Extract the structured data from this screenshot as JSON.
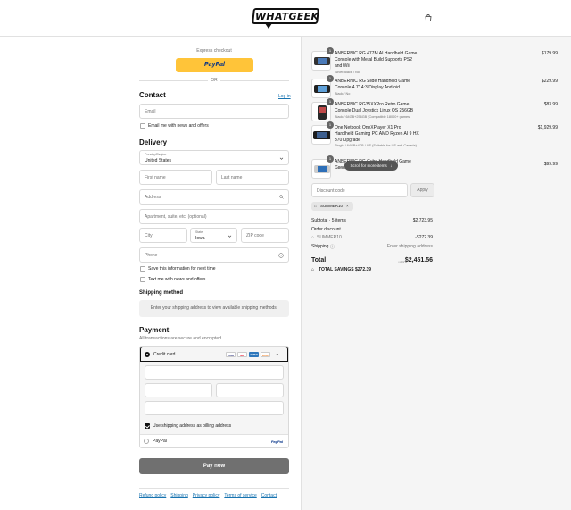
{
  "header": {
    "logo_text": "WHATGEEK",
    "cart_icon": "shopping-bag-icon"
  },
  "express": {
    "label": "Express checkout",
    "paypal_label": "PayPal",
    "or_label": "OR"
  },
  "contact": {
    "heading": "Contact",
    "login_link": "Log in",
    "email_placeholder": "Email",
    "email_news_label": "Email me with news and offers"
  },
  "delivery": {
    "heading": "Delivery",
    "country_label": "Country/Region",
    "country_value": "United States",
    "first_name": "First name",
    "last_name": "Last name",
    "address": "Address",
    "apartment": "Apartment, suite, etc. (optional)",
    "city": "City",
    "state_label": "State",
    "state_value": "Iowa",
    "zip": "ZIP code",
    "phone": "Phone",
    "save_info_label": "Save this information for next time",
    "text_news_label": "Text me with news and offers"
  },
  "shipping": {
    "heading": "Shipping method",
    "message": "Enter your shipping address to view available shipping methods."
  },
  "payment": {
    "heading": "Payment",
    "subtitle": "All transactions are secure and encrypted.",
    "credit_card_label": "Credit card",
    "card_brands": [
      "VISA",
      "MC",
      "AMEX",
      "DISC",
      "+2"
    ],
    "billing_label": "Use shipping address as billing address",
    "paypal_label": "PayPal",
    "paypal_logo": "PayPal",
    "pay_now": "Pay now"
  },
  "footer": {
    "links": [
      "Refund policy",
      "Shipping",
      "Privacy policy",
      "Terms of service",
      "Contact"
    ]
  },
  "cart": {
    "items": [
      {
        "qty": "1",
        "name": "ANBERNIC RG 477M AI Handheld Game Console with Metal Build Supports PS2 and Wii",
        "variant": "Silver Black / No",
        "price": "$179.99"
      },
      {
        "qty": "1",
        "name": "ANBERNIC RG Slide Handheld Game Console 4.7\" 4:3 Display Android",
        "variant": "Black / No",
        "price": "$229.99"
      },
      {
        "qty": "1",
        "name": "ANBERNIC RG35XXPro Retro Game Console Dual Joystick Linux OS 256GB",
        "variant": "Black / 64GB+256GB (Compatible 18000+ games)",
        "price": "$83.99"
      },
      {
        "qty": "1",
        "name": "One Netbook OneXPlayer X1 Pro Handheld Gaming PC AMD Ryzen AI 9 HX 370 Upgrade",
        "variant": "Single / 64GB+4TB / US (Suitable for US and Canada)",
        "price": "$1,929.99"
      },
      {
        "qty": "1",
        "name": "ANBERNIC RG Cube Handheld Game Console",
        "variant": "Green / No",
        "price": "$99.99"
      }
    ],
    "scroll_hint": "Scroll for more items",
    "discount_placeholder": "Discount code",
    "apply_label": "Apply",
    "applied_code": "SUMMER10",
    "subtotal_label": "Subtotal · 5 items",
    "subtotal_value": "$2,723.95",
    "order_discount_label": "Order discount",
    "discount_code_label": "SUMMER10",
    "discount_value": "-$272.39",
    "shipping_label": "Shipping",
    "shipping_value": "Enter shipping address",
    "total_label": "Total",
    "currency": "USD",
    "total_value": "$2,451.56",
    "savings_label": "TOTAL SAVINGS",
    "savings_value": "$272.39"
  }
}
